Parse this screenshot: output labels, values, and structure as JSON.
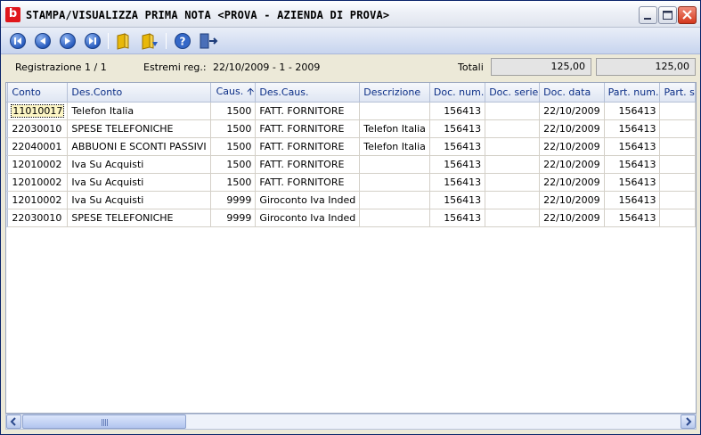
{
  "window": {
    "app_icon_letter": "b",
    "title": "STAMPA/VISUALIZZA PRIMA NOTA  <PROVA - AZIENDA DI PROVA>"
  },
  "toolbar": {
    "buttons": [
      {
        "name": "first-record-button",
        "icon": "first-icon"
      },
      {
        "name": "previous-record-button",
        "icon": "previous-icon"
      },
      {
        "name": "next-record-button",
        "icon": "next-icon"
      },
      {
        "name": "last-record-button",
        "icon": "last-icon"
      },
      {
        "name": "open-button",
        "icon": "folder-icon"
      },
      {
        "name": "print-button",
        "icon": "folder-print-icon"
      },
      {
        "name": "help-button",
        "icon": "help-icon"
      },
      {
        "name": "exit-button",
        "icon": "exit-door-icon"
      }
    ]
  },
  "info": {
    "registration": "Registrazione 1 / 1",
    "extremes_label": "Estremi reg.:",
    "extremes_value": "22/10/2009 - 1 - 2009",
    "totals_label": "Totali",
    "total_1": "125,00",
    "total_2": "125,00"
  },
  "grid": {
    "columns": [
      "Conto",
      "Des.Conto",
      "Caus.",
      "Des.Caus.",
      "Descrizione",
      "Doc. num.",
      "Doc. serie",
      "Doc. data",
      "Part. num.",
      "Part. s"
    ],
    "sort_column": "Caus.",
    "sort_icon": "sort-ascending-icon",
    "rows": [
      [
        "11010017",
        "Telefon Italia",
        "1500",
        "FATT. FORNITORE",
        "",
        "156413",
        "",
        "22/10/2009",
        "156413",
        ""
      ],
      [
        "22030010",
        "SPESE TELEFONICHE",
        "1500",
        "FATT. FORNITORE",
        "Telefon Italia",
        "156413",
        "",
        "22/10/2009",
        "156413",
        ""
      ],
      [
        "22040001",
        "ABBUONI E SCONTI PASSIVI",
        "1500",
        "FATT. FORNITORE",
        "Telefon Italia",
        "156413",
        "",
        "22/10/2009",
        "156413",
        ""
      ],
      [
        "12010002",
        "Iva Su Acquisti",
        "1500",
        "FATT. FORNITORE",
        "",
        "156413",
        "",
        "22/10/2009",
        "156413",
        ""
      ],
      [
        "12010002",
        "Iva Su Acquisti",
        "1500",
        "FATT. FORNITORE",
        "",
        "156413",
        "",
        "22/10/2009",
        "156413",
        ""
      ],
      [
        "12010002",
        "Iva Su Acquisti",
        "9999",
        "Giroconto Iva Inded",
        "",
        "156413",
        "",
        "22/10/2009",
        "156413",
        ""
      ],
      [
        "22030010",
        "SPESE TELEFONICHE",
        "9999",
        "Giroconto Iva Inded",
        "",
        "156413",
        "",
        "22/10/2009",
        "156413",
        ""
      ]
    ]
  },
  "colors": {
    "accent": "#0b2e86",
    "close_button": "#d4371c",
    "app_icon": "#e0161b"
  }
}
